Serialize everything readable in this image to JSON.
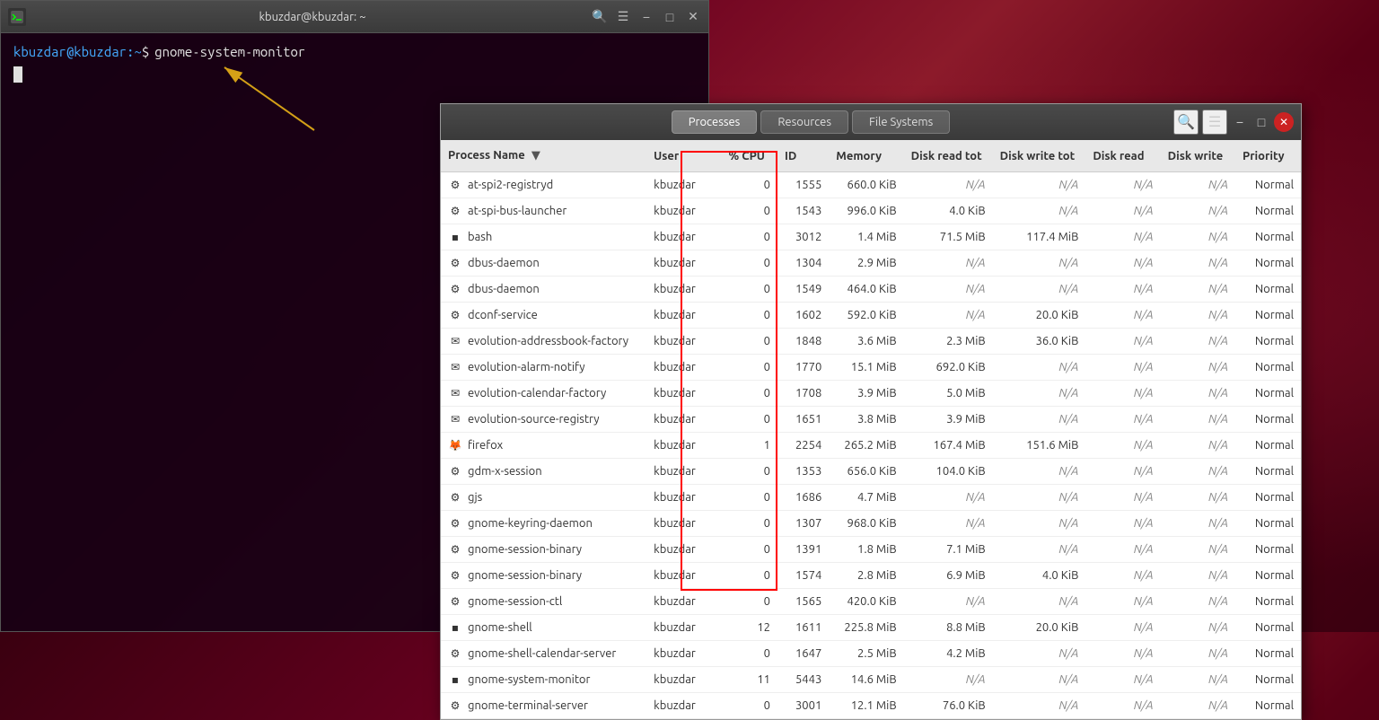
{
  "background": {
    "color": "#3a0010"
  },
  "terminal": {
    "title": "kbuzdar@kbuzdar: ~",
    "prompt_user": "kbuzdar",
    "prompt_host": "kbuzdar",
    "prompt_path": "~",
    "command": "gnome-system-monitor"
  },
  "sysmon": {
    "tabs": [
      {
        "label": "Processes",
        "active": true
      },
      {
        "label": "Resources",
        "active": false
      },
      {
        "label": "File Systems",
        "active": false
      }
    ],
    "columns": [
      {
        "key": "name",
        "label": "Process Name",
        "sorted": true
      },
      {
        "key": "user",
        "label": "User"
      },
      {
        "key": "cpu",
        "label": "% CPU"
      },
      {
        "key": "id",
        "label": "ID"
      },
      {
        "key": "memory",
        "label": "Memory"
      },
      {
        "key": "diskreadtot",
        "label": "Disk read tot"
      },
      {
        "key": "diskwritetot",
        "label": "Disk write tot"
      },
      {
        "key": "diskread",
        "label": "Disk read"
      },
      {
        "key": "diskwrite",
        "label": "Disk write"
      },
      {
        "key": "priority",
        "label": "Priority"
      }
    ],
    "processes": [
      {
        "icon": "⚙",
        "name": "at-spi2-registryd",
        "user": "kbuzdar",
        "cpu": "0",
        "id": "1555",
        "memory": "660.0 KiB",
        "diskreadtot": "N/A",
        "diskwritetot": "N/A",
        "diskread": "N/A",
        "diskwrite": "N/A",
        "priority": "Normal"
      },
      {
        "icon": "⚙",
        "name": "at-spi-bus-launcher",
        "user": "kbuzdar",
        "cpu": "0",
        "id": "1543",
        "memory": "996.0 KiB",
        "diskreadtot": "4.0 KiB",
        "diskwritetot": "N/A",
        "diskread": "N/A",
        "diskwrite": "N/A",
        "priority": "Normal"
      },
      {
        "icon": "▪",
        "name": "bash",
        "user": "kbuzdar",
        "cpu": "0",
        "id": "3012",
        "memory": "1.4 MiB",
        "diskreadtot": "71.5 MiB",
        "diskwritetot": "117.4 MiB",
        "diskread": "N/A",
        "diskwrite": "N/A",
        "priority": "Normal"
      },
      {
        "icon": "⚙",
        "name": "dbus-daemon",
        "user": "kbuzdar",
        "cpu": "0",
        "id": "1304",
        "memory": "2.9 MiB",
        "diskreadtot": "N/A",
        "diskwritetot": "N/A",
        "diskread": "N/A",
        "diskwrite": "N/A",
        "priority": "Normal"
      },
      {
        "icon": "⚙",
        "name": "dbus-daemon",
        "user": "kbuzdar",
        "cpu": "0",
        "id": "1549",
        "memory": "464.0 KiB",
        "diskreadtot": "N/A",
        "diskwritetot": "N/A",
        "diskread": "N/A",
        "diskwrite": "N/A",
        "priority": "Normal"
      },
      {
        "icon": "⚙",
        "name": "dconf-service",
        "user": "kbuzdar",
        "cpu": "0",
        "id": "1602",
        "memory": "592.0 KiB",
        "diskreadtot": "N/A",
        "diskwritetot": "20.0 KiB",
        "diskread": "N/A",
        "diskwrite": "N/A",
        "priority": "Normal"
      },
      {
        "icon": "✉",
        "name": "evolution-addressbook-factory",
        "user": "kbuzdar",
        "cpu": "0",
        "id": "1848",
        "memory": "3.6 MiB",
        "diskreadtot": "2.3 MiB",
        "diskwritetot": "36.0 KiB",
        "diskread": "N/A",
        "diskwrite": "N/A",
        "priority": "Normal"
      },
      {
        "icon": "✉",
        "name": "evolution-alarm-notify",
        "user": "kbuzdar",
        "cpu": "0",
        "id": "1770",
        "memory": "15.1 MiB",
        "diskreadtot": "692.0 KiB",
        "diskwritetot": "N/A",
        "diskread": "N/A",
        "diskwrite": "N/A",
        "priority": "Normal"
      },
      {
        "icon": "✉",
        "name": "evolution-calendar-factory",
        "user": "kbuzdar",
        "cpu": "0",
        "id": "1708",
        "memory": "3.9 MiB",
        "diskreadtot": "5.0 MiB",
        "diskwritetot": "N/A",
        "diskread": "N/A",
        "diskwrite": "N/A",
        "priority": "Normal"
      },
      {
        "icon": "✉",
        "name": "evolution-source-registry",
        "user": "kbuzdar",
        "cpu": "0",
        "id": "1651",
        "memory": "3.8 MiB",
        "diskreadtot": "3.9 MiB",
        "diskwritetot": "N/A",
        "diskread": "N/A",
        "diskwrite": "N/A",
        "priority": "Normal"
      },
      {
        "icon": "🦊",
        "name": "firefox",
        "user": "kbuzdar",
        "cpu": "1",
        "id": "2254",
        "memory": "265.2 MiB",
        "diskreadtot": "167.4 MiB",
        "diskwritetot": "151.6 MiB",
        "diskread": "N/A",
        "diskwrite": "N/A",
        "priority": "Normal"
      },
      {
        "icon": "⚙",
        "name": "gdm-x-session",
        "user": "kbuzdar",
        "cpu": "0",
        "id": "1353",
        "memory": "656.0 KiB",
        "diskreadtot": "104.0 KiB",
        "diskwritetot": "N/A",
        "diskread": "N/A",
        "diskwrite": "N/A",
        "priority": "Normal"
      },
      {
        "icon": "⚙",
        "name": "gjs",
        "user": "kbuzdar",
        "cpu": "0",
        "id": "1686",
        "memory": "4.7 MiB",
        "diskreadtot": "N/A",
        "diskwritetot": "N/A",
        "diskread": "N/A",
        "diskwrite": "N/A",
        "priority": "Normal"
      },
      {
        "icon": "⚙",
        "name": "gnome-keyring-daemon",
        "user": "kbuzdar",
        "cpu": "0",
        "id": "1307",
        "memory": "968.0 KiB",
        "diskreadtot": "N/A",
        "diskwritetot": "N/A",
        "diskread": "N/A",
        "diskwrite": "N/A",
        "priority": "Normal"
      },
      {
        "icon": "⚙",
        "name": "gnome-session-binary",
        "user": "kbuzdar",
        "cpu": "0",
        "id": "1391",
        "memory": "1.8 MiB",
        "diskreadtot": "7.1 MiB",
        "diskwritetot": "N/A",
        "diskread": "N/A",
        "diskwrite": "N/A",
        "priority": "Normal"
      },
      {
        "icon": "⚙",
        "name": "gnome-session-binary",
        "user": "kbuzdar",
        "cpu": "0",
        "id": "1574",
        "memory": "2.8 MiB",
        "diskreadtot": "6.9 MiB",
        "diskwritetot": "4.0 KiB",
        "diskread": "N/A",
        "diskwrite": "N/A",
        "priority": "Normal"
      },
      {
        "icon": "⚙",
        "name": "gnome-session-ctl",
        "user": "kbuzdar",
        "cpu": "0",
        "id": "1565",
        "memory": "420.0 KiB",
        "diskreadtot": "N/A",
        "diskwritetot": "N/A",
        "diskread": "N/A",
        "diskwrite": "N/A",
        "priority": "Normal"
      },
      {
        "icon": "▪",
        "name": "gnome-shell",
        "user": "kbuzdar",
        "cpu": "12",
        "id": "1611",
        "memory": "225.8 MiB",
        "diskreadtot": "8.8 MiB",
        "diskwritetot": "20.0 KiB",
        "diskread": "N/A",
        "diskwrite": "N/A",
        "priority": "Normal"
      },
      {
        "icon": "⚙",
        "name": "gnome-shell-calendar-server",
        "user": "kbuzdar",
        "cpu": "0",
        "id": "1647",
        "memory": "2.5 MiB",
        "diskreadtot": "4.2 MiB",
        "diskwritetot": "N/A",
        "diskread": "N/A",
        "diskwrite": "N/A",
        "priority": "Normal"
      },
      {
        "icon": "▪",
        "name": "gnome-system-monitor",
        "user": "kbuzdar",
        "cpu": "11",
        "id": "5443",
        "memory": "14.6 MiB",
        "diskreadtot": "N/A",
        "diskwritetot": "N/A",
        "diskread": "N/A",
        "diskwrite": "N/A",
        "priority": "Normal"
      },
      {
        "icon": "⚙",
        "name": "gnome-terminal-server",
        "user": "kbuzdar",
        "cpu": "0",
        "id": "3001",
        "memory": "12.1 MiB",
        "diskreadtot": "76.0 KiB",
        "diskwritetot": "N/A",
        "diskread": "N/A",
        "diskwrite": "N/A",
        "priority": "Normal"
      }
    ]
  }
}
